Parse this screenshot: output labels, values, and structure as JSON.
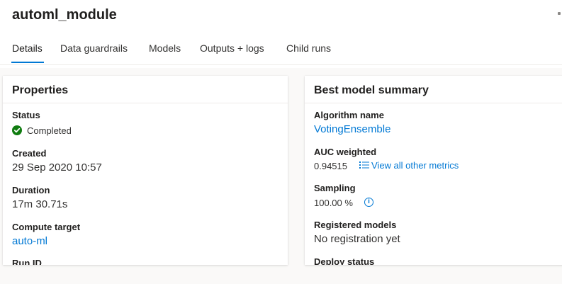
{
  "header": {
    "title": "automl_module"
  },
  "tabs": [
    {
      "label": "Details",
      "active": true
    },
    {
      "label": "Data guardrails",
      "active": false
    },
    {
      "label": "Models",
      "active": false
    },
    {
      "label": "Outputs + logs",
      "active": false
    },
    {
      "label": "Child runs",
      "active": false
    }
  ],
  "properties": {
    "title": "Properties",
    "status_label": "Status",
    "status_value": "Completed",
    "created_label": "Created",
    "created_value": "29 Sep 2020 10:57",
    "duration_label": "Duration",
    "duration_value": "17m 30.71s",
    "compute_label": "Compute target",
    "compute_value": "auto-ml",
    "runid_label": "Run ID"
  },
  "best_model": {
    "title": "Best model summary",
    "algorithm_label": "Algorithm name",
    "algorithm_value": "VotingEnsemble",
    "auc_label": "AUC weighted",
    "auc_value": "0.94515",
    "metrics_link": "View all other metrics",
    "sampling_label": "Sampling",
    "sampling_value": "100.00 %",
    "registered_label": "Registered models",
    "registered_value": "No registration yet",
    "deploy_label": "Deploy status"
  },
  "colors": {
    "accent": "#0078d4",
    "success": "#107c10"
  },
  "icons": {
    "status": "check-circle-icon",
    "metrics": "list-icon",
    "info": "info-icon"
  }
}
